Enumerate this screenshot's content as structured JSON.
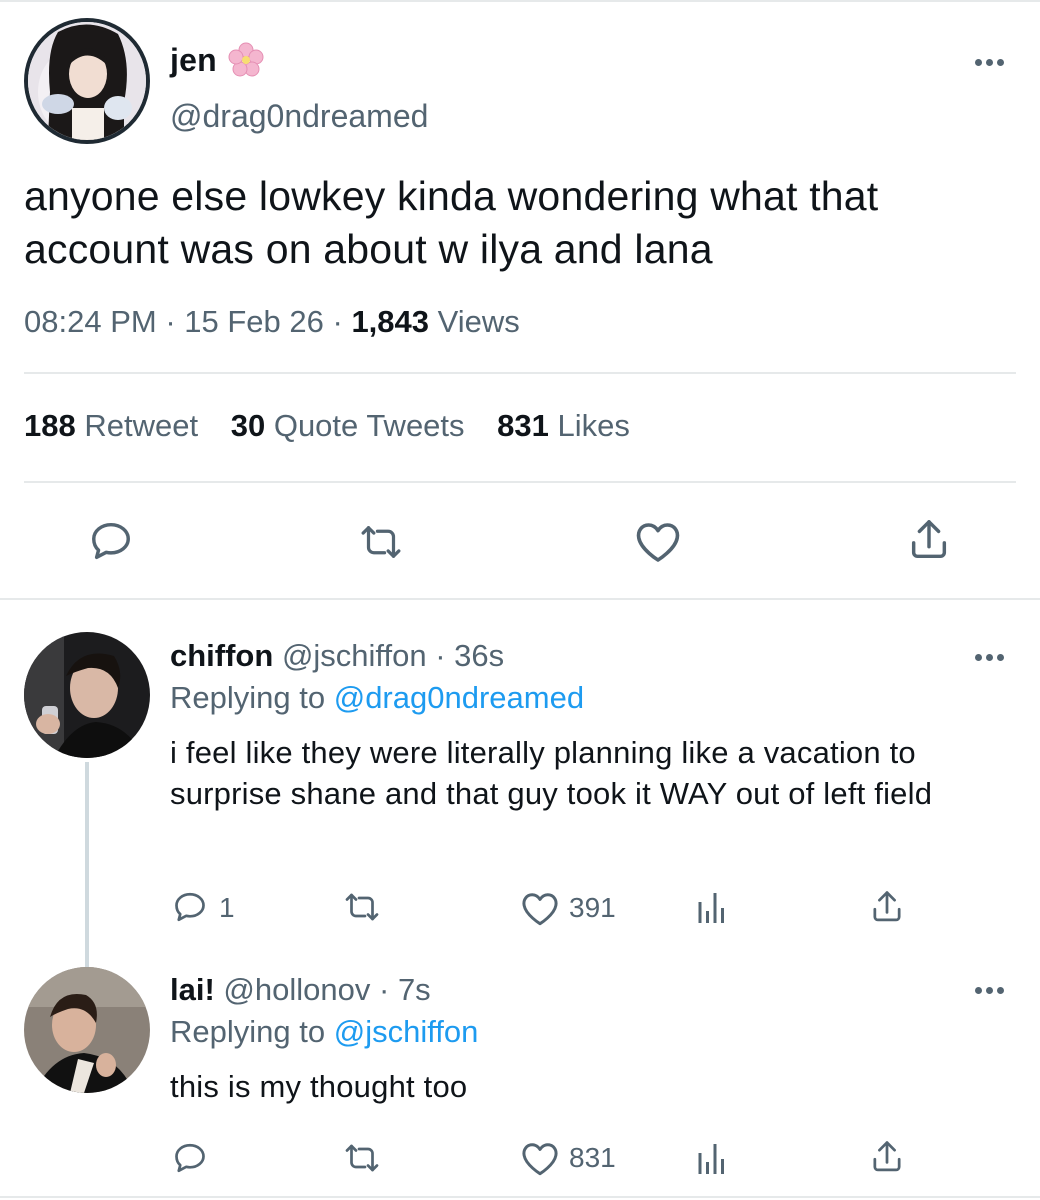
{
  "tweet": {
    "author_name": "jen",
    "author_handle": "@drag0ndreamed",
    "text": "anyone else lowkey kinda wondering what that account was on about w ilya and lana",
    "time": "08:24 PM",
    "date": "15 Feb 26",
    "views_count": "1,843",
    "views_label": "Views",
    "retweets_count": "188",
    "retweets_label": "Retweet",
    "quotes_count": "30",
    "quotes_label": "Quote Tweets",
    "likes_count": "831",
    "likes_label": "Likes",
    "actions": [
      "reply-icon",
      "retweet-icon",
      "like-icon",
      "share-icon"
    ]
  },
  "replies": [
    {
      "name": "chiffon",
      "handle": "@jschiffon",
      "age": "36s",
      "replying_label": "Replying to",
      "replying_to": "@drag0ndreamed",
      "text": "i feel like they were literally planning like a vacation to surprise shane and that guy took it WAY out of left field",
      "reply_count": "1",
      "like_count": "391"
    },
    {
      "name": "lai!",
      "handle": "@hollonov",
      "age": "7s",
      "replying_label": "Replying to",
      "replying_to": "@jschiffon",
      "text": "this is my thought too",
      "reply_count": "",
      "like_count": "831"
    }
  ],
  "colors": {
    "text": "#0f1419",
    "secondary": "#536471",
    "link": "#1d9bf0",
    "divider": "#e6e9ea"
  }
}
